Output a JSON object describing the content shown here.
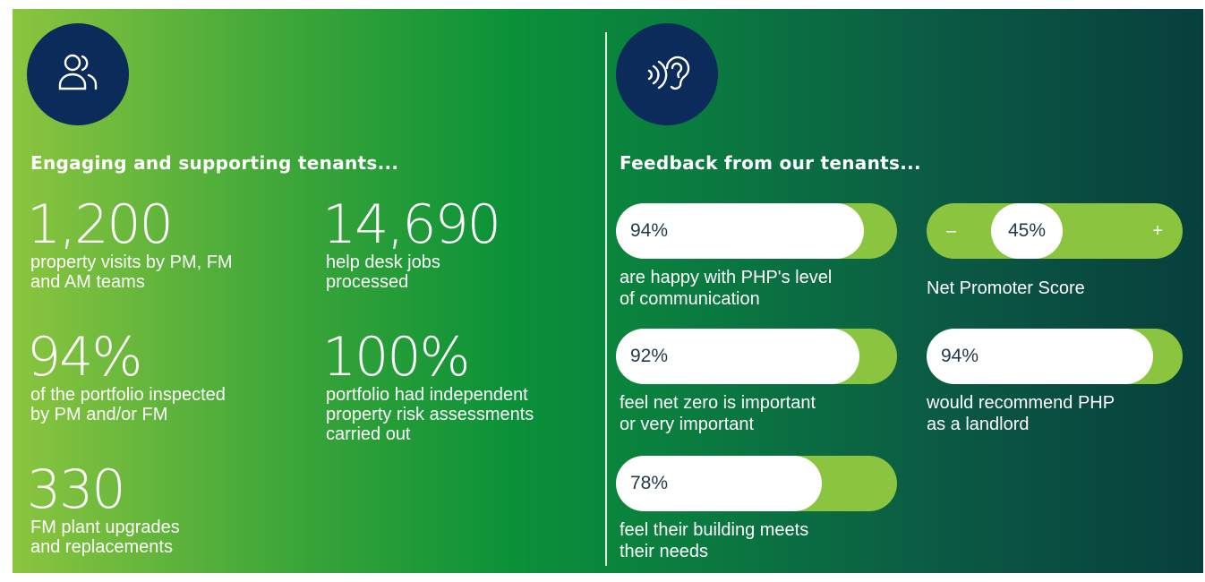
{
  "colors": {
    "panel_start": "#8bc53f",
    "panel_end": "#073f3c",
    "icon_bg": "#0b2b5a",
    "pill_track": "#8bc53f",
    "pill_fill": "#ffffff"
  },
  "left": {
    "icon": "people-icon",
    "heading": "Engaging and supporting tenants...",
    "stats": [
      {
        "number": "1,200",
        "description": "property visits by PM, FM\nand AM teams"
      },
      {
        "number": "14,690",
        "description": "help desk jobs\nprocessed"
      },
      {
        "number": "94%",
        "description": "of the portfolio inspected\nby PM and/or FM"
      },
      {
        "number": "100%",
        "description": "portfolio had independent\nproperty risk assessments\ncarried out"
      },
      {
        "number": "330",
        "description": "FM plant upgrades\nand replacements"
      }
    ]
  },
  "right": {
    "icon": "listening-ear-icon",
    "heading": "Feedback from our tenants...",
    "feedback": [
      {
        "percent_label": "94%",
        "value": 94,
        "description": "are happy with PHP's level\nof communication"
      },
      {
        "percent_label": "92%",
        "value": 92,
        "description": "feel net zero is important\nor very important"
      },
      {
        "percent_label": "78%",
        "value": 78,
        "description": "feel their building meets\ntheir needs"
      },
      {
        "percent_label": "94%",
        "value": 94,
        "description": "would recommend PHP\nas a landlord"
      }
    ],
    "nps": {
      "value_label": "45%",
      "value": 45,
      "minus": "–",
      "plus": "+",
      "label": "Net Promoter Score"
    }
  }
}
